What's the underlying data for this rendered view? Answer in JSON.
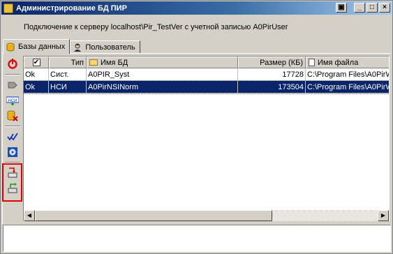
{
  "window": {
    "title": "Администрирование БД ПИР",
    "buttons": {
      "restore": "▣",
      "minimize": "_",
      "maximize": "□",
      "close": "×"
    }
  },
  "connection_text": "Подключение к серверу localhost\\Pir_TestVer с учетной записью A0PirUser",
  "tabs": [
    {
      "label": "Базы данных",
      "icon": "database-icon",
      "active": true
    },
    {
      "label": "Пользователь",
      "icon": "user-icon",
      "active": false
    }
  ],
  "toolbar": {
    "items": [
      {
        "icon": "refresh-icon"
      },
      {
        "icon": "connect-db-icon"
      },
      {
        "icon": "nsi-icon"
      },
      {
        "icon": "delete-db-icon"
      },
      {
        "icon": "check-all-icon"
      },
      {
        "icon": "settings-db-icon"
      },
      {
        "icon": "import-icon"
      },
      {
        "icon": "export-icon"
      }
    ]
  },
  "grid": {
    "columns": [
      "",
      "Тип",
      "Имя БД",
      "Размер (КБ)",
      "Имя файла"
    ],
    "header_checkbox": "✔",
    "rows": [
      {
        "status": "Ok",
        "type": "Сист.",
        "name": "A0PIR_Syst",
        "size": "17728",
        "file": "C:\\Program Files\\A0PirWi",
        "selected": false
      },
      {
        "status": "Ok",
        "type": "НСИ",
        "name": "A0PirNSINorm",
        "size": "173504",
        "file": "C:\\Program Files\\A0PirWi",
        "selected": true
      }
    ]
  },
  "scrollbar": {
    "left_arrow": "◀",
    "right_arrow": "▶"
  },
  "colors": {
    "titlebar": "#0a246a",
    "selection": "#0a246a",
    "highlight_box": "#e00000"
  }
}
